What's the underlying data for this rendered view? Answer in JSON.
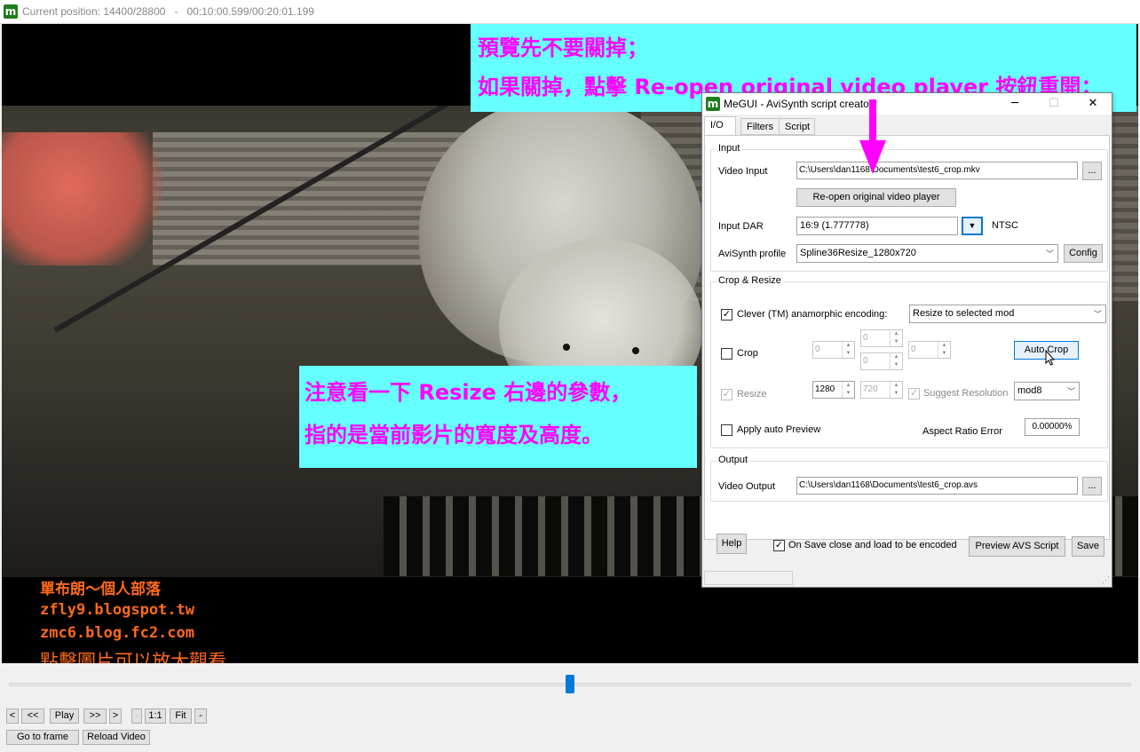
{
  "player": {
    "title": "Current position: 14400/28800   -   00:10:00.599/00:20:01.199",
    "icon": "megui-icon",
    "annotation_top": {
      "line1": "預覽先不要關掉；",
      "line2": "如果關掉，點擊 Re-open original video player 按鈕重開；"
    },
    "annotation_mid": {
      "line1": "注意看一下 Resize 右邊的參數，",
      "line2": "指的是當前影片的寬度及高度。"
    },
    "watermark": {
      "line1": "單布朗～個人部落",
      "line2": "zfly9.blogspot.tw",
      "line3": "zmc6.blog.fc2.com",
      "line4": "點擊圖片可以放大觀看"
    },
    "controls": {
      "prev": "<",
      "rewind": "<<",
      "play": "Play",
      "forward": ">>",
      "next": ">",
      "zoom_minus_small": "-",
      "one_to_one": "1:1",
      "fit": "Fit",
      "zoom_minus": "-",
      "go_to_frame": "Go to frame",
      "reload_video": "Reload Video"
    },
    "seek_position": 0.5
  },
  "dialog": {
    "title": "MeGUI - AviSynth script creator",
    "minimize": "─",
    "maximize": "☐",
    "close": "✕",
    "tabs": [
      "I/O",
      "Filters",
      "Script"
    ],
    "input": {
      "group_label": "Input",
      "video_input_label": "Video Input",
      "video_input_value": "C:\\Users\\dan1168\\Documents\\test6_crop.mkv",
      "browse": "...",
      "reopen_button": "Re-open original video player",
      "input_dar_label": "Input DAR",
      "input_dar_value": "16:9 (1.777778)",
      "dar_standard": "NTSC",
      "avisynth_profile_label": "AviSynth profile",
      "avisynth_profile_value": "Spline36Resize_1280x720",
      "config_button": "Config"
    },
    "crop_resize": {
      "group_label": "Crop & Resize",
      "clever_label": "Clever (TM) anamorphic encoding:",
      "clever_checked": true,
      "clever_mode": "Resize to selected mod",
      "crop_label": "Crop",
      "crop_left": "0",
      "crop_top": "0",
      "crop_bottom": "0",
      "crop_right": "0",
      "auto_crop_button": "Auto Crop",
      "resize_label": "Resize",
      "resize_width": "1280",
      "resize_height": "720",
      "suggest_resolution_label": "Suggest Resolution",
      "mod_value": "mod8",
      "apply_preview_label": "Apply auto Preview",
      "aspect_ratio_error_label": "Aspect Ratio Error",
      "aspect_ratio_error_value": "0.00000%"
    },
    "output": {
      "group_label": "Output",
      "video_output_label": "Video Output",
      "video_output_value": "C:\\Users\\dan1168\\Documents\\test6_crop.avs",
      "browse": "..."
    },
    "bottom": {
      "help_button": "Help",
      "on_save_label": "On Save close and load to be encoded",
      "on_save_checked": true,
      "preview_button": "Preview AVS Script",
      "save_button": "Save"
    }
  },
  "colors": {
    "annotation_bg": "#66ffff",
    "annotation_text": "#ff00ff",
    "watermark_text": "#ff6a1a",
    "accent": "#0078d7",
    "arrow": "#ff00ff"
  }
}
